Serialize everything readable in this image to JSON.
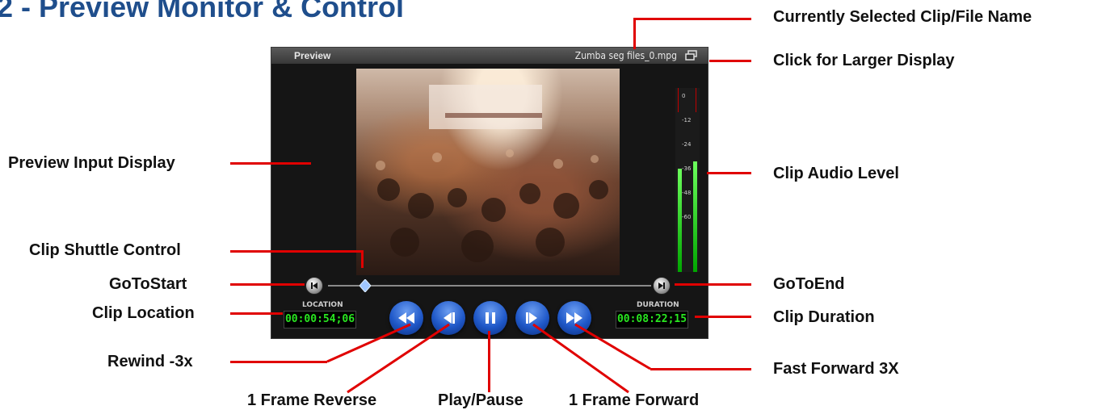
{
  "heading": "2 - Preview Monitor & Control",
  "panel": {
    "title": "Preview",
    "filename": "Zumba seg files_0.mpg",
    "location_label": "LOCATION",
    "location_value": "00:00:54;06",
    "duration_label": "DURATION",
    "duration_value": "00:08:22;15",
    "meter_ticks": [
      "0",
      "-12",
      "-24",
      "-36",
      "-48",
      "-60"
    ],
    "meter_levels": [
      0.56,
      0.6
    ]
  },
  "callouts": {
    "filename": "Currently Selected Clip/File Name",
    "larger_display": "Click for Larger Display",
    "preview_input": "Preview Input Display",
    "audio_level": "Clip Audio Level",
    "shuttle": "Clip Shuttle Control",
    "goto_start": "GoToStart",
    "goto_end": "GoToEnd",
    "location": "Clip Location",
    "duration": "Clip Duration",
    "rewind": "Rewind -3x",
    "fast_forward": "Fast Forward 3X",
    "frame_reverse": "1 Frame Reverse",
    "play_pause": "Play/Pause",
    "frame_forward": "1 Frame Forward"
  },
  "colors": {
    "heading": "#1f4e8c",
    "callout_line": "#e00000",
    "timecode": "#29e620",
    "transport": "#1f58c8"
  },
  "icons": {
    "enlarge": "window-restore-icon",
    "goto_start": "skip-start-icon",
    "goto_end": "skip-end-icon",
    "rewind": "rewind-icon",
    "frame_reverse": "step-back-icon",
    "play_pause": "pause-icon",
    "frame_forward": "step-forward-icon",
    "fast_forward": "fast-forward-icon"
  }
}
